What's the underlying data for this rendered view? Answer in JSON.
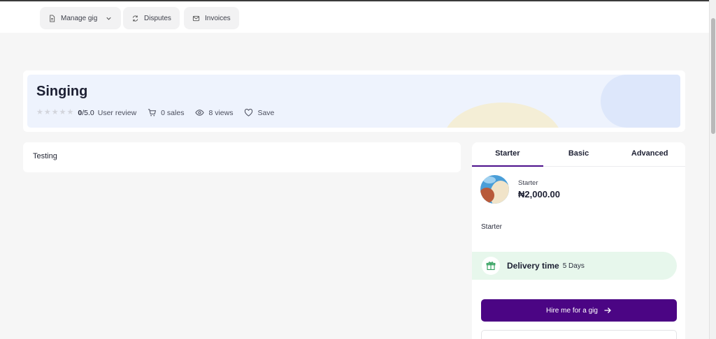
{
  "topbar": {
    "manage_gig": "Manage gig",
    "disputes": "Disputes",
    "invoices": "Invoices"
  },
  "gig": {
    "title": "Singing",
    "rating": "0",
    "rating_max": "/5.0",
    "review_label": "User review",
    "stars_filled": 0,
    "stars_total": 5,
    "sales": "0 sales",
    "views": "8 views",
    "save_label": "Save"
  },
  "description": "Testing",
  "packages": {
    "tabs": [
      "Starter",
      "Basic",
      "Advanced"
    ],
    "active_tab": "Starter",
    "name": "Starter",
    "price": "₦2,000.00",
    "description": "Starter",
    "delivery_label": "Delivery time",
    "delivery_value": "5 Days",
    "hire_label": "Hire me for a gig"
  },
  "colors": {
    "accent": "#4b0584",
    "delivery_bg": "#e7f7ec",
    "hero_bg": "#eef3fd"
  },
  "icons": {
    "manage_gig": "document-icon",
    "disputes": "refresh-icon",
    "invoices": "mail-icon",
    "sales": "cart-icon",
    "views": "eye-icon",
    "save": "heart-icon",
    "delivery": "gift-icon",
    "hire": "arrow-right-icon"
  }
}
